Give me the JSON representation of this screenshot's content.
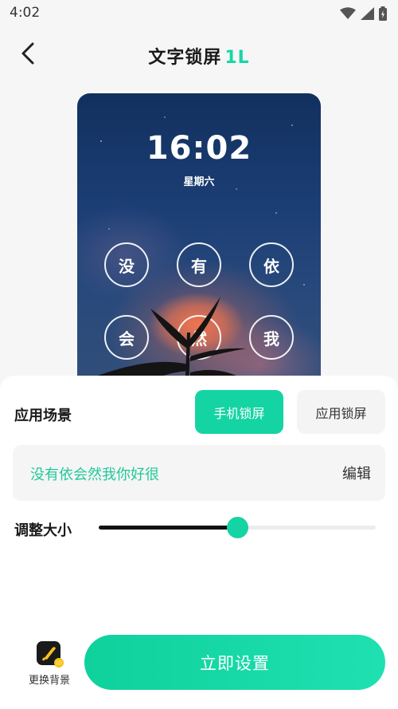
{
  "status_bar": {
    "time": "4:02"
  },
  "header": {
    "title": "文字锁屏",
    "title_mark": "1L"
  },
  "preview": {
    "time": "16:02",
    "weekday": "星期六",
    "characters": [
      "没",
      "有",
      "依",
      "会",
      "然",
      "我"
    ]
  },
  "panel": {
    "scene_label": "应用场景",
    "scene_options": [
      "手机锁屏",
      "应用锁屏"
    ],
    "scene_selected": "手机锁屏",
    "text_value": "没有依会然我你好很",
    "edit_label": "编辑",
    "size_label": "调整大小",
    "size_level": 0.5,
    "change_background_label": "更换背景",
    "apply_button": "立即设置"
  },
  "colors": {
    "accent": "#14d4a3",
    "text_accent": "#21c99a"
  }
}
